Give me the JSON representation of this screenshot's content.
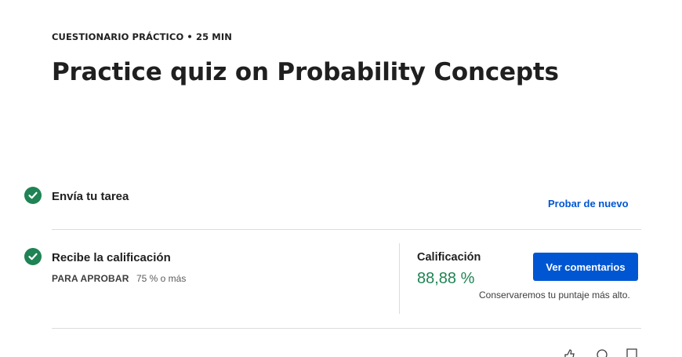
{
  "header": {
    "eyebrow": "CUESTIONARIO PRÁCTICO • 25 MIN",
    "title": "Practice quiz on Probability Concepts"
  },
  "submit_step": {
    "label": "Envía tu tarea",
    "retry_label": "Probar de nuevo",
    "icon": "check-circle-icon"
  },
  "grade_step": {
    "label": "Recibe la calificación",
    "pass_key": "PARA APROBAR",
    "pass_value": "75 % o más",
    "icon": "check-circle-icon"
  },
  "grade": {
    "label": "Calificación",
    "value": "88,88 %",
    "button_label": "Ver comentarios",
    "note": "Conservaremos tu puntaje más alto."
  },
  "colors": {
    "success": "#1f8354",
    "primary": "#0056d2",
    "divider": "#dcdcdc"
  },
  "bottom_icons": [
    "like-icon",
    "dislike-icon",
    "flag-icon"
  ]
}
